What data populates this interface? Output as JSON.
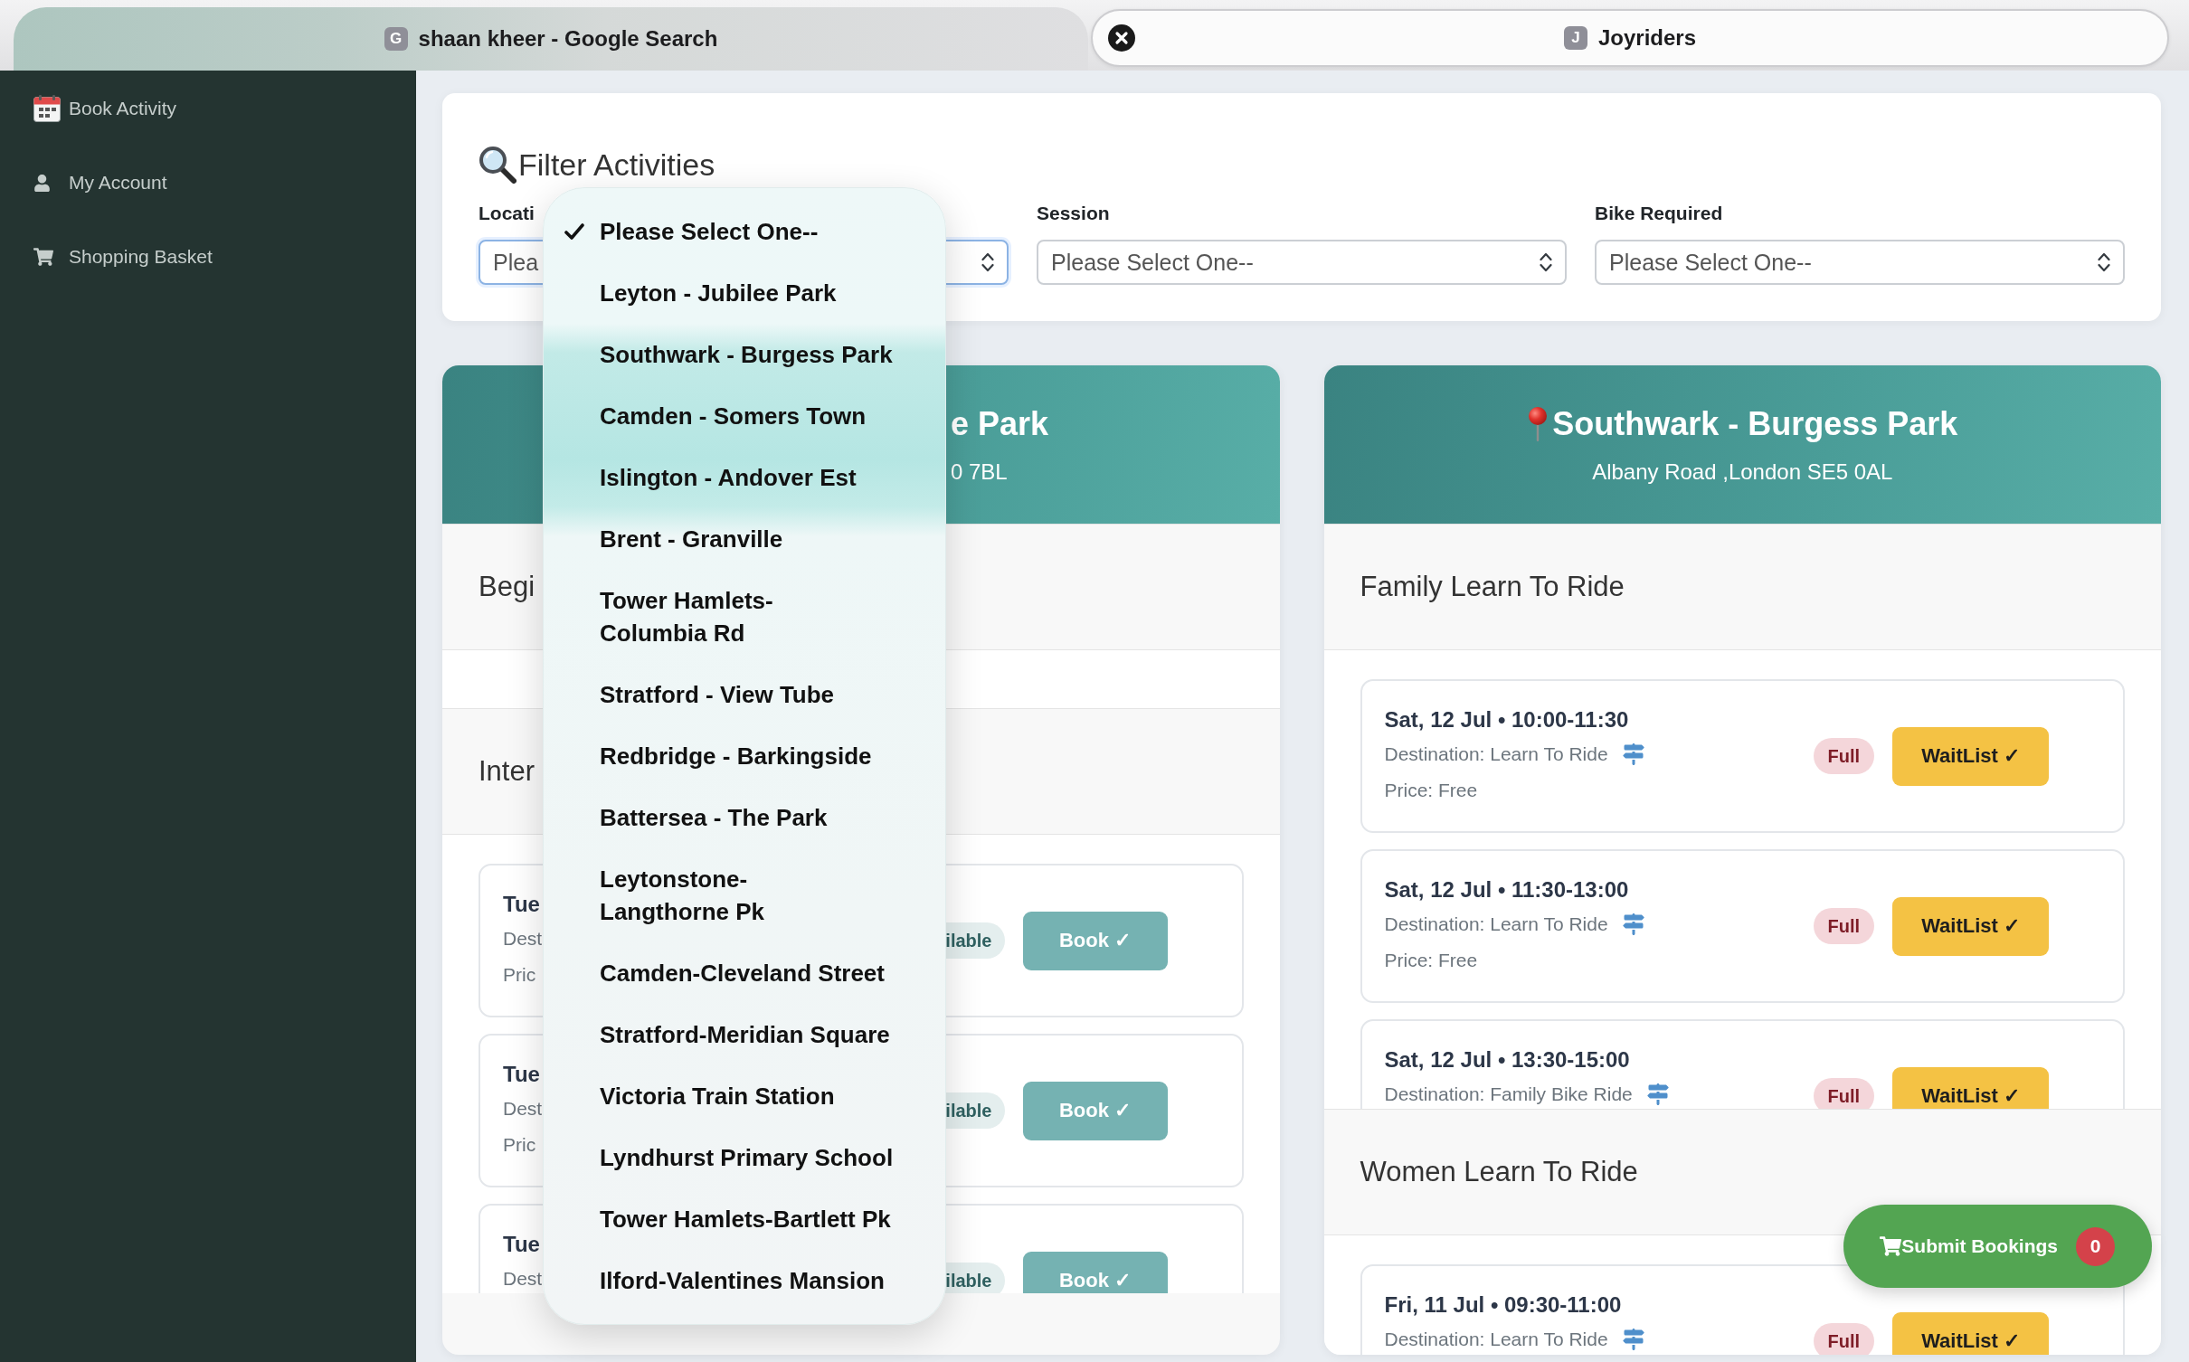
{
  "browser_tabs": [
    {
      "favicon": "G",
      "title": "shaan kheer - Google Search",
      "selected": false
    },
    {
      "favicon": "J",
      "title": "Joyriders",
      "selected": true
    }
  ],
  "sidebar": {
    "items": [
      {
        "label": "Book Activity",
        "selected": false
      },
      {
        "label": "My Account",
        "selected": false
      },
      {
        "label": "Shopping Basket",
        "selected": false
      }
    ]
  },
  "filter": {
    "title": "Filter Activities",
    "fields": [
      {
        "label": "Locati",
        "value": "Plea",
        "open": true,
        "options": [
          {
            "label": "Please Select One--",
            "selected": true
          },
          {
            "label": "Leyton - Jubilee Park",
            "selected": false
          },
          {
            "label": "Southwark - Burgess Park",
            "selected": false
          },
          {
            "label": "Camden - Somers Town",
            "selected": false
          },
          {
            "label": "Islington - Andover Est",
            "selected": false
          },
          {
            "label": "Brent - Granville",
            "selected": false
          },
          {
            "label": "Tower Hamlets-\nColumbia Rd",
            "selected": false
          },
          {
            "label": "Stratford - View Tube",
            "selected": false
          },
          {
            "label": "Redbridge - Barkingside",
            "selected": false
          },
          {
            "label": "Battersea - The Park",
            "selected": false
          },
          {
            "label": "Leytonstone-\nLangthorne Pk",
            "selected": false
          },
          {
            "label": "Camden-Cleveland Street",
            "selected": false
          },
          {
            "label": "Stratford-Meridian Square",
            "selected": false
          },
          {
            "label": "Victoria Train Station",
            "selected": false
          },
          {
            "label": "Lyndhurst Primary School",
            "selected": false
          },
          {
            "label": "Tower Hamlets-Bartlett Pk",
            "selected": false
          },
          {
            "label": "Ilford-Valentines Mansion",
            "selected": false
          }
        ]
      },
      {
        "label": "Session",
        "value": "Please Select One--",
        "open": false
      },
      {
        "label": "Bike Required",
        "value": "Please Select One--",
        "open": false
      }
    ]
  },
  "locations": [
    {
      "title": "e Park",
      "address": "0 7BL",
      "sections": [
        {
          "title": "Begi"
        },
        {
          "title": "Inter",
          "sessions": [
            {
              "kind": "available",
              "date": "Tue",
              "destination": "Dest",
              "price": "Pric",
              "status": "ilable",
              "action": "Book ✓"
            },
            {
              "kind": "available",
              "date": "Tue",
              "destination": "Dest",
              "price": "Pric",
              "status": "ilable",
              "action": "Book ✓"
            },
            {
              "kind": "available",
              "date": "Tue",
              "destination": "Dest",
              "status": "ilable",
              "action": "Book ✓"
            }
          ]
        }
      ]
    },
    {
      "title": "Southwark - Burgess Park",
      "address": "Albany Road ,London SE5 0AL",
      "sections": [
        {
          "title": "Family Learn To Ride",
          "sessions": [
            {
              "kind": "full",
              "date": "Sat, 12 Jul • 10:00-11:30",
              "destination": "Destination: Learn To Ride",
              "price": "Price: Free",
              "status": "Full",
              "action": "WaitList ✓"
            },
            {
              "kind": "full",
              "date": "Sat, 12 Jul • 11:30-13:00",
              "destination": "Destination: Learn To Ride",
              "price": "Price: Free",
              "status": "Full",
              "action": "WaitList ✓"
            },
            {
              "kind": "full",
              "date": "Sat, 12 Jul • 13:30-15:00",
              "destination": "Destination: Family Bike Ride",
              "status": "Full",
              "action": "WaitList ✓"
            }
          ]
        },
        {
          "title": "Women Learn To Ride",
          "sessions": [
            {
              "kind": "full",
              "date": "Fri, 11 Jul • 09:30-11:00",
              "destination": "Destination: Learn To Ride",
              "status": "Full",
              "action": "WaitList ✓"
            }
          ]
        }
      ]
    }
  ],
  "submit": {
    "label": "Submit Bookings",
    "count": "0"
  }
}
